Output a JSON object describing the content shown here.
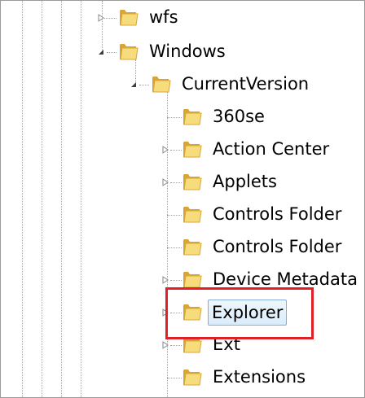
{
  "tree": {
    "nodes": [
      {
        "label": "wfs",
        "state": "collapsed"
      },
      {
        "label": "Windows",
        "state": "expanded"
      },
      {
        "label": "CurrentVersion",
        "state": "expanded"
      },
      {
        "label": "360se",
        "state": "leaf"
      },
      {
        "label": "Action Center",
        "state": "collapsed"
      },
      {
        "label": "Applets",
        "state": "collapsed"
      },
      {
        "label": "Controls Folder",
        "state": "leaf"
      },
      {
        "label": "Controls Folder",
        "state": "leaf"
      },
      {
        "label": "Device Metadata",
        "state": "collapsed"
      },
      {
        "label": "Explorer",
        "state": "collapsed",
        "selected": true,
        "highlighted": true
      },
      {
        "label": "Ext",
        "state": "collapsed"
      },
      {
        "label": "Extensions",
        "state": "leaf"
      }
    ]
  },
  "colors": {
    "folder_light": "#f6dc7c",
    "folder_dark": "#d9a635",
    "highlight_border": "#e02027",
    "selection_border": "#84acdd"
  }
}
